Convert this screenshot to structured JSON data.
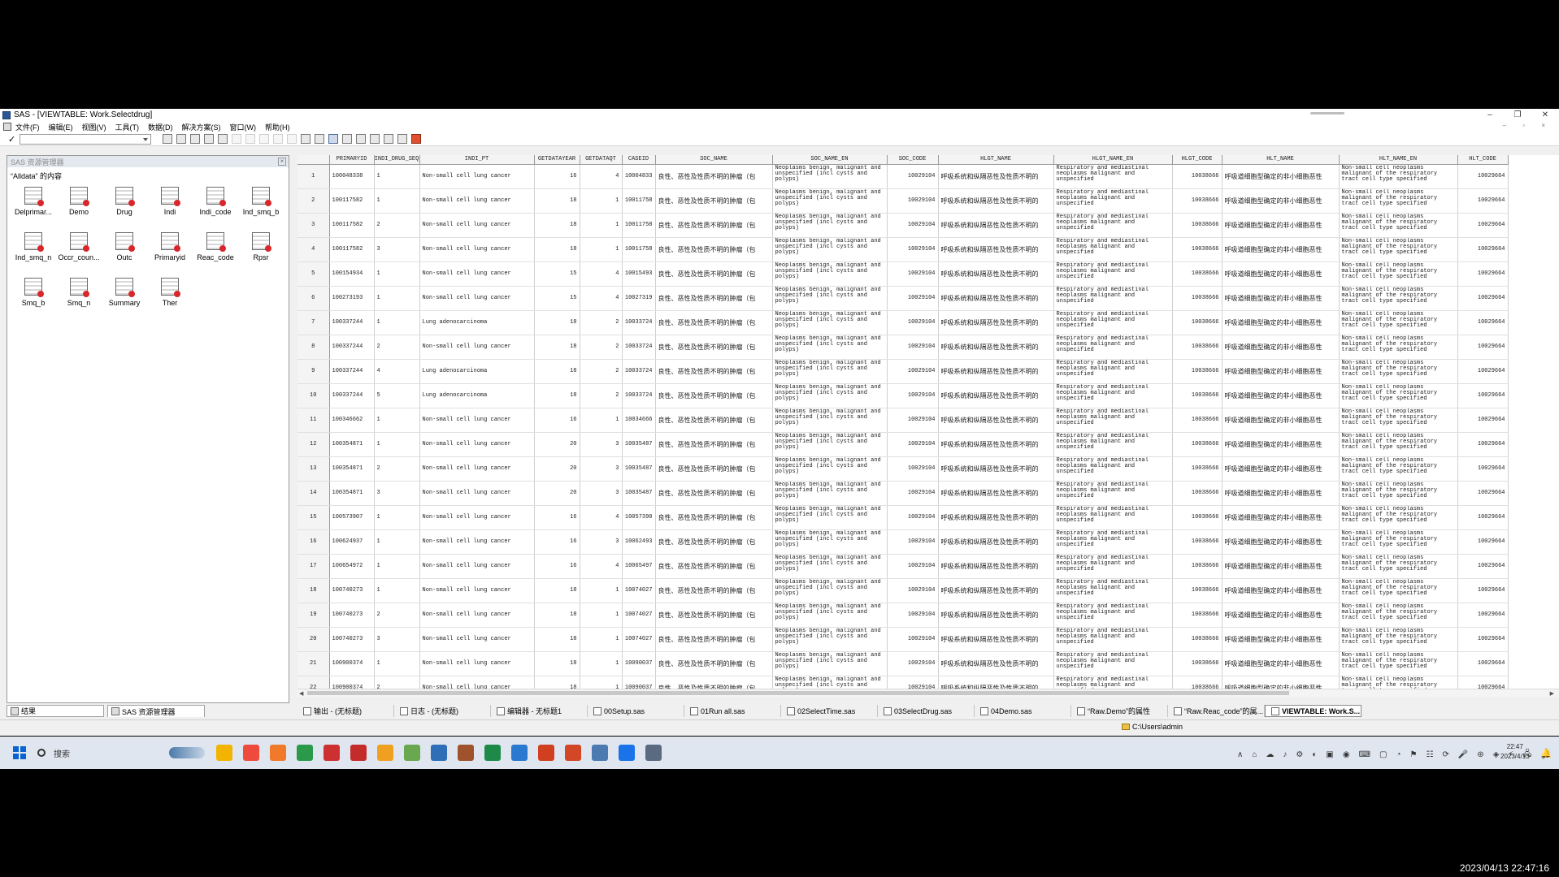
{
  "window": {
    "title": "SAS - [VIEWTABLE: Work.Selectdrug]",
    "controls": [
      "–",
      "❐",
      "✕"
    ]
  },
  "menu": {
    "items": [
      "文件(F)",
      "编辑(E)",
      "视图(V)",
      "工具(T)",
      "数据(D)",
      "解决方案(S)",
      "窗口(W)",
      "帮助(H)"
    ],
    "mdi_controls": "– ▫ ×"
  },
  "toolbar": {
    "checkmark": "✓",
    "command_value": ""
  },
  "explorer": {
    "header": "SAS 资源管理器",
    "close": "×",
    "caption": "“Alldata” 的内容",
    "libraries": [
      "Delprimar...",
      "Demo",
      "Drug",
      "Indi",
      "Indi_code",
      "Ind_smq_b",
      "Ind_smq_n",
      "Occr_coun...",
      "Outc",
      "Primaryid",
      "Reac_code",
      "Rpsr",
      "Smq_b",
      "Smq_n",
      "Summary",
      "Ther"
    ],
    "tabs": [
      "结果",
      "SAS 资源管理器"
    ]
  },
  "table": {
    "columns": [
      "",
      "PRIMARYID",
      "INDI_DRUG_SEQ",
      "INDI_PT",
      "GETDATAYEAR",
      "GETDATAQT",
      "CASEID",
      "SOC_NAME",
      "SOC_NAME_EN",
      "SOC_CODE",
      "HLGT_NAME",
      "HLGT_NAME_EN",
      "HLGT_CODE",
      "HLT_NAME",
      "HLT_NAME_EN",
      "HLT_CODE"
    ],
    "soc_name": "良性、恶性及性质不明的肿瘤（包",
    "soc_name_en": "Neoplasms benign, malignant and unspecified (incl cysts and polyps)",
    "soc_code": "10029104",
    "hlgt_name": "呼吸系统和纵隔恶性及性质不明的",
    "hlgt_name_en": "Respiratory and mediastinal neoplasms malignant and unspecified",
    "hlgt_code": "10038666",
    "hlt_name": "呼吸道细胞型确定的非小细胞恶性",
    "hlt_name_en": "Non-small cell neoplasms malignant of the respiratory tract cell type specified",
    "hlt_code": "10029664",
    "rows": [
      [
        "1",
        "100048338",
        "1",
        "Non-small cell lung cancer",
        "16",
        "4",
        "10004833"
      ],
      [
        "2",
        "100117582",
        "1",
        "Non-small cell lung cancer",
        "18",
        "1",
        "10011758"
      ],
      [
        "3",
        "100117582",
        "2",
        "Non-small cell lung cancer",
        "18",
        "1",
        "10011758"
      ],
      [
        "4",
        "100117582",
        "3",
        "Non-small cell lung cancer",
        "18",
        "1",
        "10011758"
      ],
      [
        "5",
        "100154934",
        "1",
        "Non-small cell lung cancer",
        "15",
        "4",
        "10015493"
      ],
      [
        "6",
        "100273193",
        "1",
        "Non-small cell lung cancer",
        "15",
        "4",
        "10027319"
      ],
      [
        "7",
        "100337244",
        "1",
        "Lung adenocarcinoma",
        "18",
        "2",
        "10033724"
      ],
      [
        "8",
        "100337244",
        "2",
        "Non-small cell lung cancer",
        "18",
        "2",
        "10033724"
      ],
      [
        "9",
        "100337244",
        "4",
        "Lung adenocarcinoma",
        "18",
        "2",
        "10033724"
      ],
      [
        "10",
        "100337244",
        "5",
        "Lung adenocarcinoma",
        "18",
        "2",
        "10033724"
      ],
      [
        "11",
        "100346662",
        "1",
        "Non-small cell lung cancer",
        "16",
        "1",
        "10034666"
      ],
      [
        "12",
        "100354871",
        "1",
        "Non-small cell lung cancer",
        "20",
        "3",
        "10035487"
      ],
      [
        "13",
        "100354871",
        "2",
        "Non-small cell lung cancer",
        "20",
        "3",
        "10035487"
      ],
      [
        "14",
        "100354871",
        "3",
        "Non-small cell lung cancer",
        "20",
        "3",
        "10035487"
      ],
      [
        "15",
        "100573907",
        "1",
        "Non-small cell lung cancer",
        "16",
        "4",
        "10057390"
      ],
      [
        "16",
        "100624937",
        "1",
        "Non-small cell lung cancer",
        "16",
        "3",
        "10062493"
      ],
      [
        "17",
        "100654972",
        "1",
        "Non-small cell lung cancer",
        "16",
        "4",
        "10065497"
      ],
      [
        "18",
        "100740273",
        "1",
        "Non-small cell lung cancer",
        "18",
        "1",
        "10074027"
      ],
      [
        "19",
        "100740273",
        "2",
        "Non-small cell lung cancer",
        "18",
        "1",
        "10074027"
      ],
      [
        "20",
        "100740273",
        "3",
        "Non-small cell lung cancer",
        "18",
        "1",
        "10074027"
      ],
      [
        "21",
        "100900374",
        "1",
        "Non-small cell lung cancer",
        "18",
        "1",
        "10090037"
      ],
      [
        "22",
        "100900374",
        "2",
        "Non-small cell lung cancer",
        "18",
        "1",
        "10090037"
      ]
    ]
  },
  "window_tabs": [
    "输出 - (无标题)",
    "日志 - (无标题)",
    "编辑器 - 无标题1",
    "00Setup.sas",
    "01Run all.sas",
    "02SelectTime.sas",
    "03SelectDrug.sas",
    "04Demo.sas",
    "“Raw.Demo”的属性",
    "“Raw.Reac_code”的属...",
    "VIEWTABLE: Work.S..."
  ],
  "statusbar": {
    "path": "C:\\Users\\admin"
  },
  "taskbar": {
    "search_label": "搜索",
    "app_colors": [
      "#f2b400",
      "#ef4b3c",
      "#f07a2a",
      "#2a9a4a",
      "#cc3030",
      "#c42c2c",
      "#f0a020",
      "#6aa84f",
      "#2f6fb8",
      "#a0522d",
      "#1e8a4a",
      "#2a78d0",
      "#d04020",
      "#d24726",
      "#4a7ab0",
      "#1a73e8",
      "#5a6a80"
    ],
    "tray_glyphs": [
      "∧",
      "⌂",
      "☁",
      "♪",
      "⚙",
      "◐",
      "▣",
      "◉",
      "⌨",
      "▢",
      "◔",
      "⚑",
      "☷",
      "⟳",
      "🎤",
      "⊛",
      "◈",
      "⚡",
      "🖧",
      "🔊"
    ],
    "time": "22:47",
    "date": "2023/4/13",
    "bell": "🔔"
  },
  "overlay_timestamp": "2023/04/13 22:47:16"
}
